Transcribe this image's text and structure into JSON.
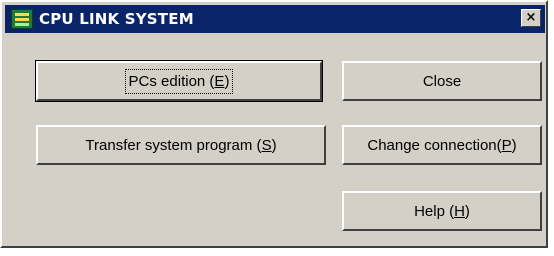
{
  "window": {
    "title": "CPU LINK SYSTEM",
    "close_glyph": "×"
  },
  "buttons": {
    "pcs_edition": {
      "text": "PCs edition (",
      "hotkey": "E",
      "suffix": ")"
    },
    "close": {
      "text": "Close"
    },
    "transfer_system_program": {
      "text": "Transfer system program (",
      "hotkey": "S",
      "suffix": ")"
    },
    "change_connection": {
      "text": "Change connection(",
      "hotkey": "P",
      "suffix": ")"
    },
    "help": {
      "text": "Help (",
      "hotkey": "H",
      "suffix": ")"
    }
  },
  "colors": {
    "titlebar": "#0a246a",
    "face": "#d4d0c8",
    "icon_green": "#1d7a3b"
  }
}
